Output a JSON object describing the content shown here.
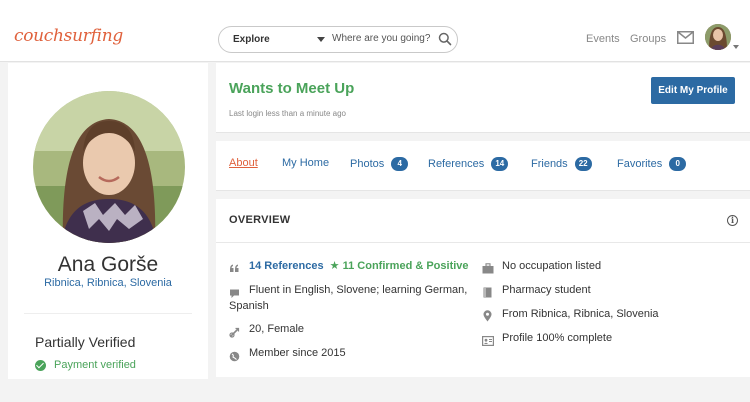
{
  "nav": {
    "logo": "couchsurfing",
    "explore_label": "Explore",
    "search_placeholder": "Where are you going?",
    "events": "Events",
    "groups": "Groups"
  },
  "profile": {
    "name": "Ana Gorše",
    "location": "Ribnica, Ribnica, Slovenia",
    "verification_title": "Partially Verified",
    "payment_verified": "Payment verified"
  },
  "header": {
    "status": "Wants to Meet Up",
    "last_login": "Last login less than a minute ago",
    "edit_button": "Edit My Profile"
  },
  "tabs": [
    {
      "label": "About",
      "count": null,
      "active": true
    },
    {
      "label": "My Home",
      "count": null,
      "active": false
    },
    {
      "label": "Photos",
      "count": "4",
      "active": false
    },
    {
      "label": "References",
      "count": "14",
      "active": false
    },
    {
      "label": "Friends",
      "count": "22",
      "active": false
    },
    {
      "label": "Favorites",
      "count": "0",
      "active": false
    }
  ],
  "overview": {
    "title": "OVERVIEW",
    "references": "14 References",
    "confirmed": "11 Confirmed & Positive",
    "languages": "Fluent in English, Slovene; learning German, Spanish",
    "age_gender": "20, Female",
    "member_since": "Member since 2015",
    "occupation": "No occupation listed",
    "education": "Pharmacy student",
    "from": "From Ribnica, Ribnica, Slovenia",
    "profile_complete": "Profile 100% complete"
  },
  "colors": {
    "brand": "#e0613c",
    "link": "#2c6aa3",
    "positive": "#4aa35a"
  }
}
